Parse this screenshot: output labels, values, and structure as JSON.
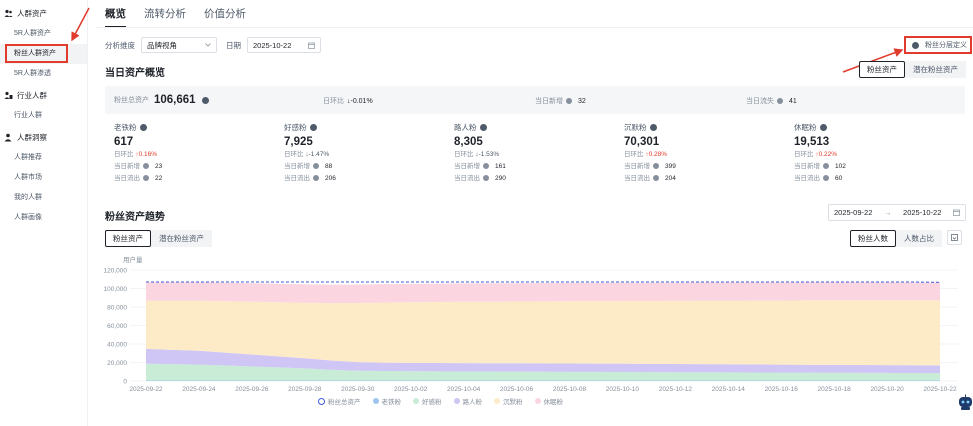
{
  "sidebar": {
    "groups": [
      {
        "label": "人群资产",
        "icon": "people-icon",
        "items": [
          "5R人群资产",
          "粉丝人群资产",
          "5R人群渗透"
        ]
      },
      {
        "label": "行业人群",
        "icon": "industry-people-icon",
        "items": [
          "行业人群"
        ]
      },
      {
        "label": "人群洞察",
        "icon": "insight-person-icon",
        "items": [
          "人群推荐",
          "人群市场",
          "我的人群",
          "人群画像"
        ]
      }
    ],
    "active_item": "粉丝人群资产"
  },
  "tabs": [
    "概览",
    "流转分析",
    "价值分析"
  ],
  "active_tab": "概览",
  "filters": {
    "dimension_label": "分析维度",
    "dimension_value": "品牌视角",
    "date_label": "日期",
    "date_value": "2025-10-22"
  },
  "definition_link": "粉丝分层定义",
  "overview": {
    "title": "当日资产概览",
    "toggle": [
      "粉丝资产",
      "潜在粉丝资产"
    ],
    "toggle_selected": "粉丝资产",
    "total_label": "粉丝总资产",
    "total_value": "106,661",
    "day_ratio_label": "日环比",
    "day_ratio_value": "↓-0.01%",
    "new_label": "当日新增",
    "new_value": "32",
    "lost_label": "当日流失",
    "lost_value": "41"
  },
  "cards": [
    {
      "name": "老铁粉",
      "value": "617",
      "ratio_label": "日环比",
      "ratio": "↑0.16%",
      "trend": "up",
      "new_label": "当日新增",
      "new": "23",
      "lost_label": "当日流出",
      "lost": "22"
    },
    {
      "name": "好感粉",
      "value": "7,925",
      "ratio_label": "日环比",
      "ratio": "↓-1.47%",
      "trend": "down",
      "new_label": "当日新增",
      "new": "88",
      "lost_label": "当日流出",
      "lost": "206"
    },
    {
      "name": "路人粉",
      "value": "8,305",
      "ratio_label": "日环比",
      "ratio": "↓-1.53%",
      "trend": "down",
      "new_label": "当日新增",
      "new": "161",
      "lost_label": "当日流出",
      "lost": "290"
    },
    {
      "name": "沉默粉",
      "value": "70,301",
      "ratio_label": "日环比",
      "ratio": "↑0.28%",
      "trend": "up",
      "new_label": "当日新增",
      "new": "399",
      "lost_label": "当日流出",
      "lost": "204"
    },
    {
      "name": "休眠粉",
      "value": "19,513",
      "ratio_label": "日环比",
      "ratio": "↑0.22%",
      "trend": "up",
      "new_label": "当日新增",
      "new": "102",
      "lost_label": "当日流出",
      "lost": "60"
    }
  ],
  "trend": {
    "title": "粉丝资产趋势",
    "range_start": "2025-09-22",
    "range_sep": "→",
    "range_end": "2025-10-22",
    "toggle": [
      "粉丝资产",
      "潜在粉丝资产"
    ],
    "toggle_selected": "粉丝资产",
    "metric_toggle": [
      "粉丝人数",
      "人数占比"
    ],
    "metric_selected": "粉丝人数"
  },
  "colors": {
    "total": "#3b5bdb",
    "laotie": "#9ec5f0",
    "haogan": "#c8ecd6",
    "luren": "#cfc6f5",
    "chenmo": "#fdebc8",
    "xiumian": "#fbd6e0",
    "annotation_red": "#e03b2c"
  },
  "chart_data": {
    "type": "area",
    "ylabel": "用户量",
    "ylim": [
      0,
      120000
    ],
    "yticks": [
      "0",
      "20,000",
      "40,000",
      "60,000",
      "80,000",
      "100,000",
      "120,000"
    ],
    "x": [
      "2025-09-22",
      "2025-09-23",
      "2025-09-24",
      "2025-09-25",
      "2025-09-26",
      "2025-09-27",
      "2025-09-28",
      "2025-09-29",
      "2025-09-30",
      "2025-10-01",
      "2025-10-02",
      "2025-10-03",
      "2025-10-04",
      "2025-10-05",
      "2025-10-06",
      "2025-10-07",
      "2025-10-08",
      "2025-10-09",
      "2025-10-10",
      "2025-10-11",
      "2025-10-12",
      "2025-10-13",
      "2025-10-14",
      "2025-10-15",
      "2025-10-16",
      "2025-10-17",
      "2025-10-18",
      "2025-10-19",
      "2025-10-20",
      "2025-10-21",
      "2025-10-22"
    ],
    "xticks": [
      "2025-09-22",
      "2025-09-24",
      "2025-09-26",
      "2025-09-28",
      "2025-09-30",
      "2025-10-02",
      "2025-10-04",
      "2025-10-06",
      "2025-10-08",
      "2025-10-10",
      "2025-10-12",
      "2025-10-14",
      "2025-10-16",
      "2025-10-18",
      "2025-10-20",
      "2025-10-22"
    ],
    "series": [
      {
        "name": "粉丝总资产",
        "kind": "line",
        "values": [
          107000,
          107000,
          107000,
          107000,
          107000,
          107000,
          107000,
          107000,
          107000,
          107000,
          107000,
          107000,
          107000,
          107000,
          107000,
          107000,
          107000,
          107000,
          107000,
          107000,
          107000,
          107000,
          107000,
          107000,
          107000,
          107000,
          107000,
          107000,
          107000,
          107000,
          106661
        ]
      },
      {
        "name": "老铁粉",
        "values": [
          700,
          700,
          700,
          690,
          680,
          670,
          660,
          650,
          640,
          630,
          630,
          630,
          630,
          630,
          630,
          630,
          630,
          630,
          630,
          630,
          625,
          625,
          620,
          620,
          620,
          620,
          620,
          620,
          618,
          617,
          617
        ]
      },
      {
        "name": "好感粉",
        "values": [
          18000,
          17500,
          17000,
          16000,
          15000,
          14000,
          13000,
          11500,
          10500,
          10200,
          10000,
          9800,
          9700,
          9600,
          9500,
          9400,
          9300,
          9200,
          9100,
          9000,
          8900,
          8800,
          8700,
          8600,
          8500,
          8400,
          8300,
          8200,
          8100,
          8040,
          7925
        ]
      },
      {
        "name": "路人粉",
        "values": [
          16000,
          15500,
          15000,
          14000,
          13000,
          12000,
          11000,
          10000,
          9200,
          9000,
          9000,
          9000,
          9000,
          9000,
          9000,
          9000,
          9000,
          9000,
          9000,
          8900,
          8900,
          8800,
          8800,
          8700,
          8600,
          8600,
          8500,
          8500,
          8400,
          8430,
          8305
        ]
      },
      {
        "name": "沉默粉",
        "values": [
          52000,
          53000,
          54000,
          55500,
          57000,
          58500,
          60000,
          62000,
          64000,
          65000,
          65500,
          66000,
          66300,
          66500,
          66800,
          67000,
          67300,
          67500,
          67800,
          68000,
          68200,
          68500,
          68700,
          69000,
          69200,
          69500,
          69700,
          69900,
          70000,
          70100,
          70301
        ]
      },
      {
        "name": "休眠粉",
        "values": [
          20000,
          20000,
          20000,
          20000,
          20000,
          20000,
          20000,
          20000,
          20000,
          20000,
          19900,
          19900,
          19900,
          19900,
          19800,
          19800,
          19800,
          19800,
          19700,
          19700,
          19700,
          19700,
          19600,
          19600,
          19600,
          19600,
          19600,
          19500,
          19500,
          19470,
          19513
        ]
      }
    ]
  }
}
